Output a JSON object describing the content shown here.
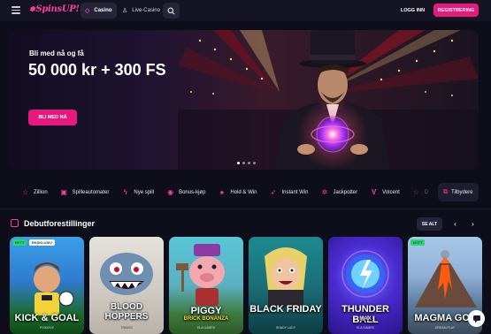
{
  "header": {
    "logo_text": "SpinsUP!",
    "tabs": [
      {
        "label": "Casino",
        "icon": "diamond-icon"
      },
      {
        "label": "Live-Casino",
        "icon": "person-icon"
      }
    ],
    "login_label": "LOGG INN",
    "register_label": "REGISTRERING"
  },
  "hero": {
    "subtitle": "Bli med nå og få",
    "title": "50 000 kr + 300 FS",
    "cta_label": "BLI MED NÅ"
  },
  "categories": [
    {
      "label": "Zillion",
      "icon": "star-icon"
    },
    {
      "label": "Spilleautomater",
      "icon": "slot-icon"
    },
    {
      "label": "Nye spill",
      "icon": "bolt-icon"
    },
    {
      "label": "Bonus-kjøp",
      "icon": "coin-icon"
    },
    {
      "label": "Hold & Win",
      "icon": "spade-icon"
    },
    {
      "label": "Instant Win",
      "icon": "rocket-icon"
    },
    {
      "label": "Jackpotter",
      "icon": "gear-icon"
    },
    {
      "label": "Volcent",
      "icon": "v-icon"
    },
    {
      "label": "D",
      "icon": "star-icon"
    }
  ],
  "providers_label": "Tilbydere",
  "section": {
    "title": "Debutforestillinger",
    "see_all": "SE ALT"
  },
  "games": [
    {
      "name": "KICK & GOAL",
      "provider": "PIXMOVE",
      "badges": [
        "NYTT",
        "EKSKLUSIV"
      ]
    },
    {
      "name": "BLOOD HOPPERS",
      "provider": "TRINGS",
      "badges": []
    },
    {
      "name": "PIGGY",
      "name2": "BRICK BONANZA",
      "provider": "ELA GAMES",
      "badges": []
    },
    {
      "name": "BLACK FRIDAY",
      "provider": "SHADY LADY",
      "badges": []
    },
    {
      "name": "THUNDER BALL",
      "name2": "MAX",
      "provider": "ELA GAMES",
      "badges": []
    },
    {
      "name": "MAGMA GOL",
      "provider": "DREAM PLAY",
      "badges": [
        "NYTT"
      ]
    }
  ]
}
